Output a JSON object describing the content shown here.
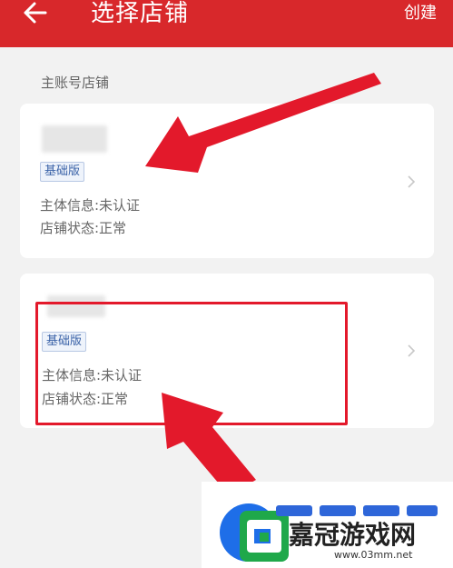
{
  "header": {
    "title": "选择店铺",
    "create_label": "创建",
    "back_icon": "arrow-left-icon"
  },
  "section": {
    "label": "主账号店铺"
  },
  "stores": [
    {
      "badge": "基础版",
      "info_line1": "主体信息:未认证",
      "info_line2": "店铺状态:正常"
    },
    {
      "badge": "基础版",
      "info_line1": "主体信息:未认证",
      "info_line2": "店铺状态:正常"
    }
  ],
  "watermark": {
    "text": "嘉冠游戏网",
    "url": "www.03mm.net"
  },
  "colors": {
    "header": "#d8282b",
    "accent": "#e3192b",
    "badge_text": "#3b63a8"
  }
}
